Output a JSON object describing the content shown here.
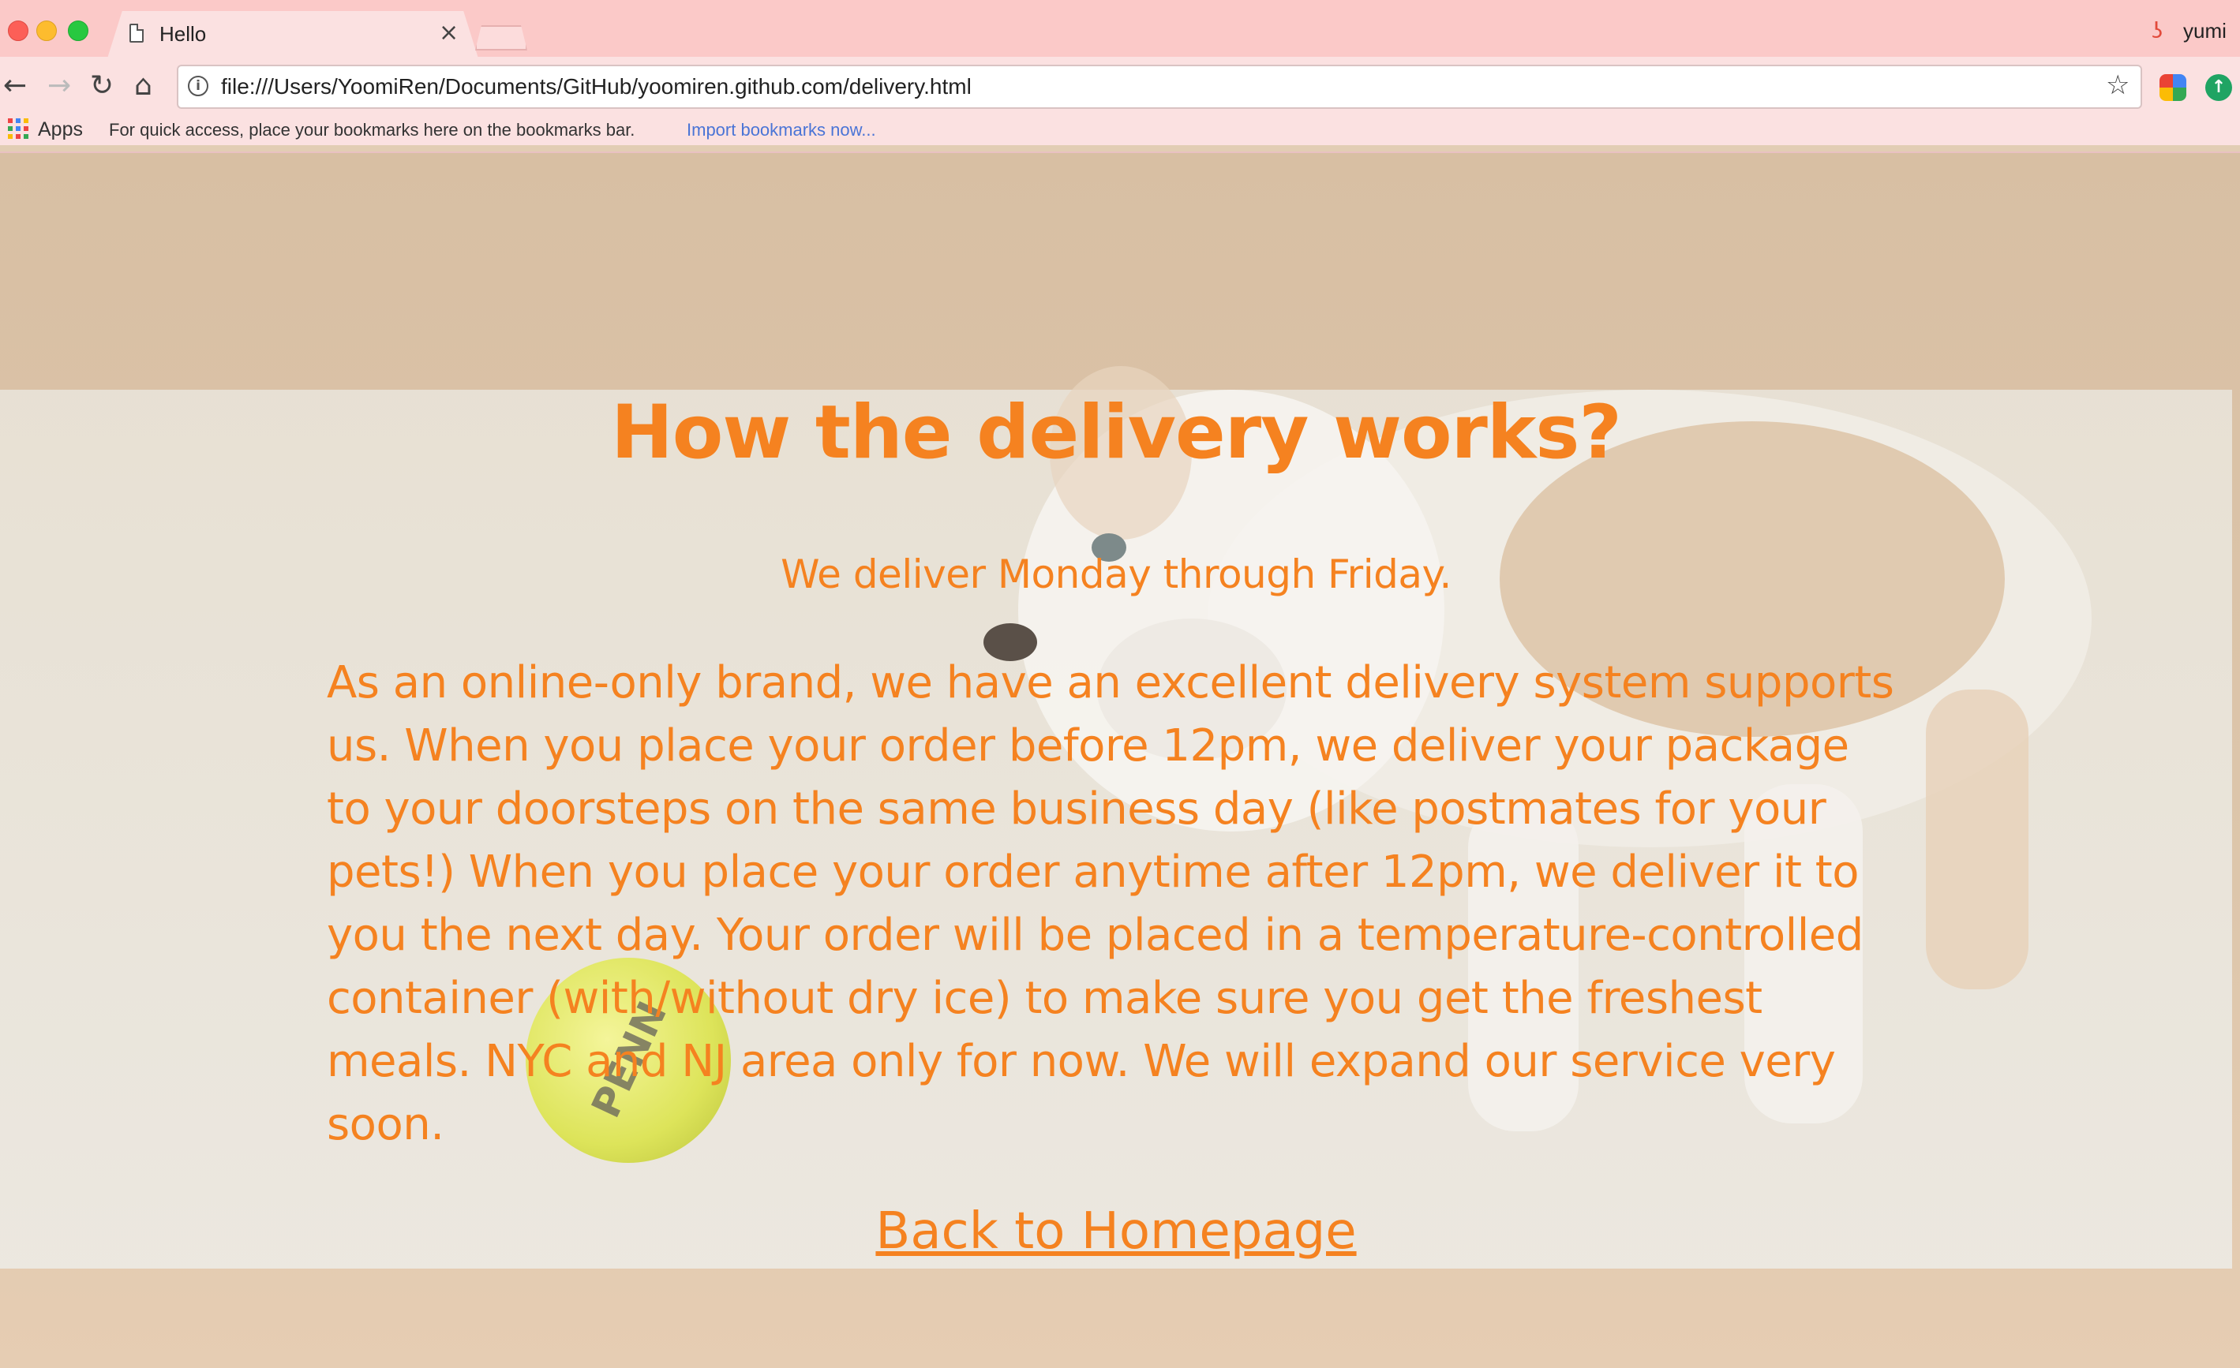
{
  "browser": {
    "tab": {
      "title": "Hello",
      "close_glyph": "×"
    },
    "profile": {
      "name": "yumi",
      "icon": "profile-icon"
    },
    "nav": {
      "back": "←",
      "forward": "→",
      "reload": "↻",
      "home": "⌂"
    },
    "address": {
      "url": "file:///Users/YoomiRen/Documents/GitHub/yoomiren.github.com/delivery.html",
      "info_glyph": "i",
      "star_glyph": "☆"
    },
    "bookmarks_bar": {
      "apps_label": "Apps",
      "hint": "For quick access, place your bookmarks here on the bookmarks bar.",
      "import_link": "Import bookmarks now..."
    }
  },
  "page": {
    "heading": "How the delivery works?",
    "subheading": "We deliver Monday through Friday.",
    "body": "As an online-only brand, we have an excellent delivery system supports us. When you place your order before 12pm, we deliver your package to your doorsteps on the same business day (like postmates for your pets!) When you place your order anytime after 12pm, we deliver it to you the next day. Your order will be placed in a temperature-controlled container (with/without dry ice) to make sure you get the freshest meals. NYC and NJ area only for now. We will expand our service very soon.",
    "back_link": "Back to Homepage",
    "colors": {
      "accent": "#f58220",
      "chrome": "#fbc9c8"
    }
  }
}
